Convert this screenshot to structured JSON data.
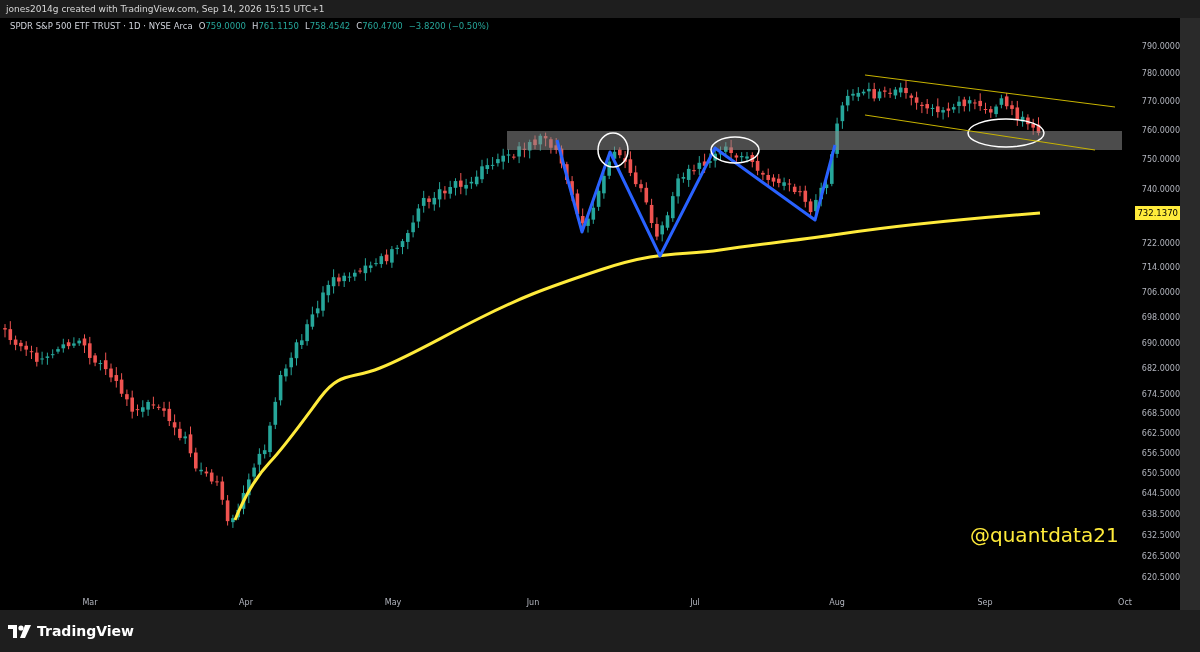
{
  "credit": "jones2014g created with TradingView.com, Sep 14, 2026 15:15 UTC+1",
  "legend": {
    "symbol": "SPDR S&P 500 ETF TRUST · 1D · NYSE Arca",
    "ohlc": [
      {
        "label": "O",
        "value": "759.0000"
      },
      {
        "label": "H",
        "value": "761.1150"
      },
      {
        "label": "L",
        "value": "758.4542"
      },
      {
        "label": "C",
        "value": "760.4700"
      }
    ],
    "change": "−3.8200 (−0.50%)"
  },
  "price_axis": {
    "ticks": [
      "790.0000",
      "780.0000",
      "770.0000",
      "760.0000",
      "750.0000",
      "740.0000",
      "722.0000",
      "714.0000",
      "706.0000",
      "698.0000",
      "690.0000",
      "682.0000",
      "674.5000",
      "668.5000",
      "662.5000",
      "656.5000",
      "650.5000",
      "644.5000",
      "638.5000",
      "632.5000",
      "626.5000",
      "620.5000"
    ],
    "current_price": "732.1370"
  },
  "time_axis": {
    "labels": [
      "Mar",
      "Apr",
      "May",
      "Jun",
      "Jul",
      "Aug",
      "Sep",
      "Oct"
    ]
  },
  "annotation_text": "@quantdata21",
  "footer": {
    "brand": "TradingView"
  }
}
